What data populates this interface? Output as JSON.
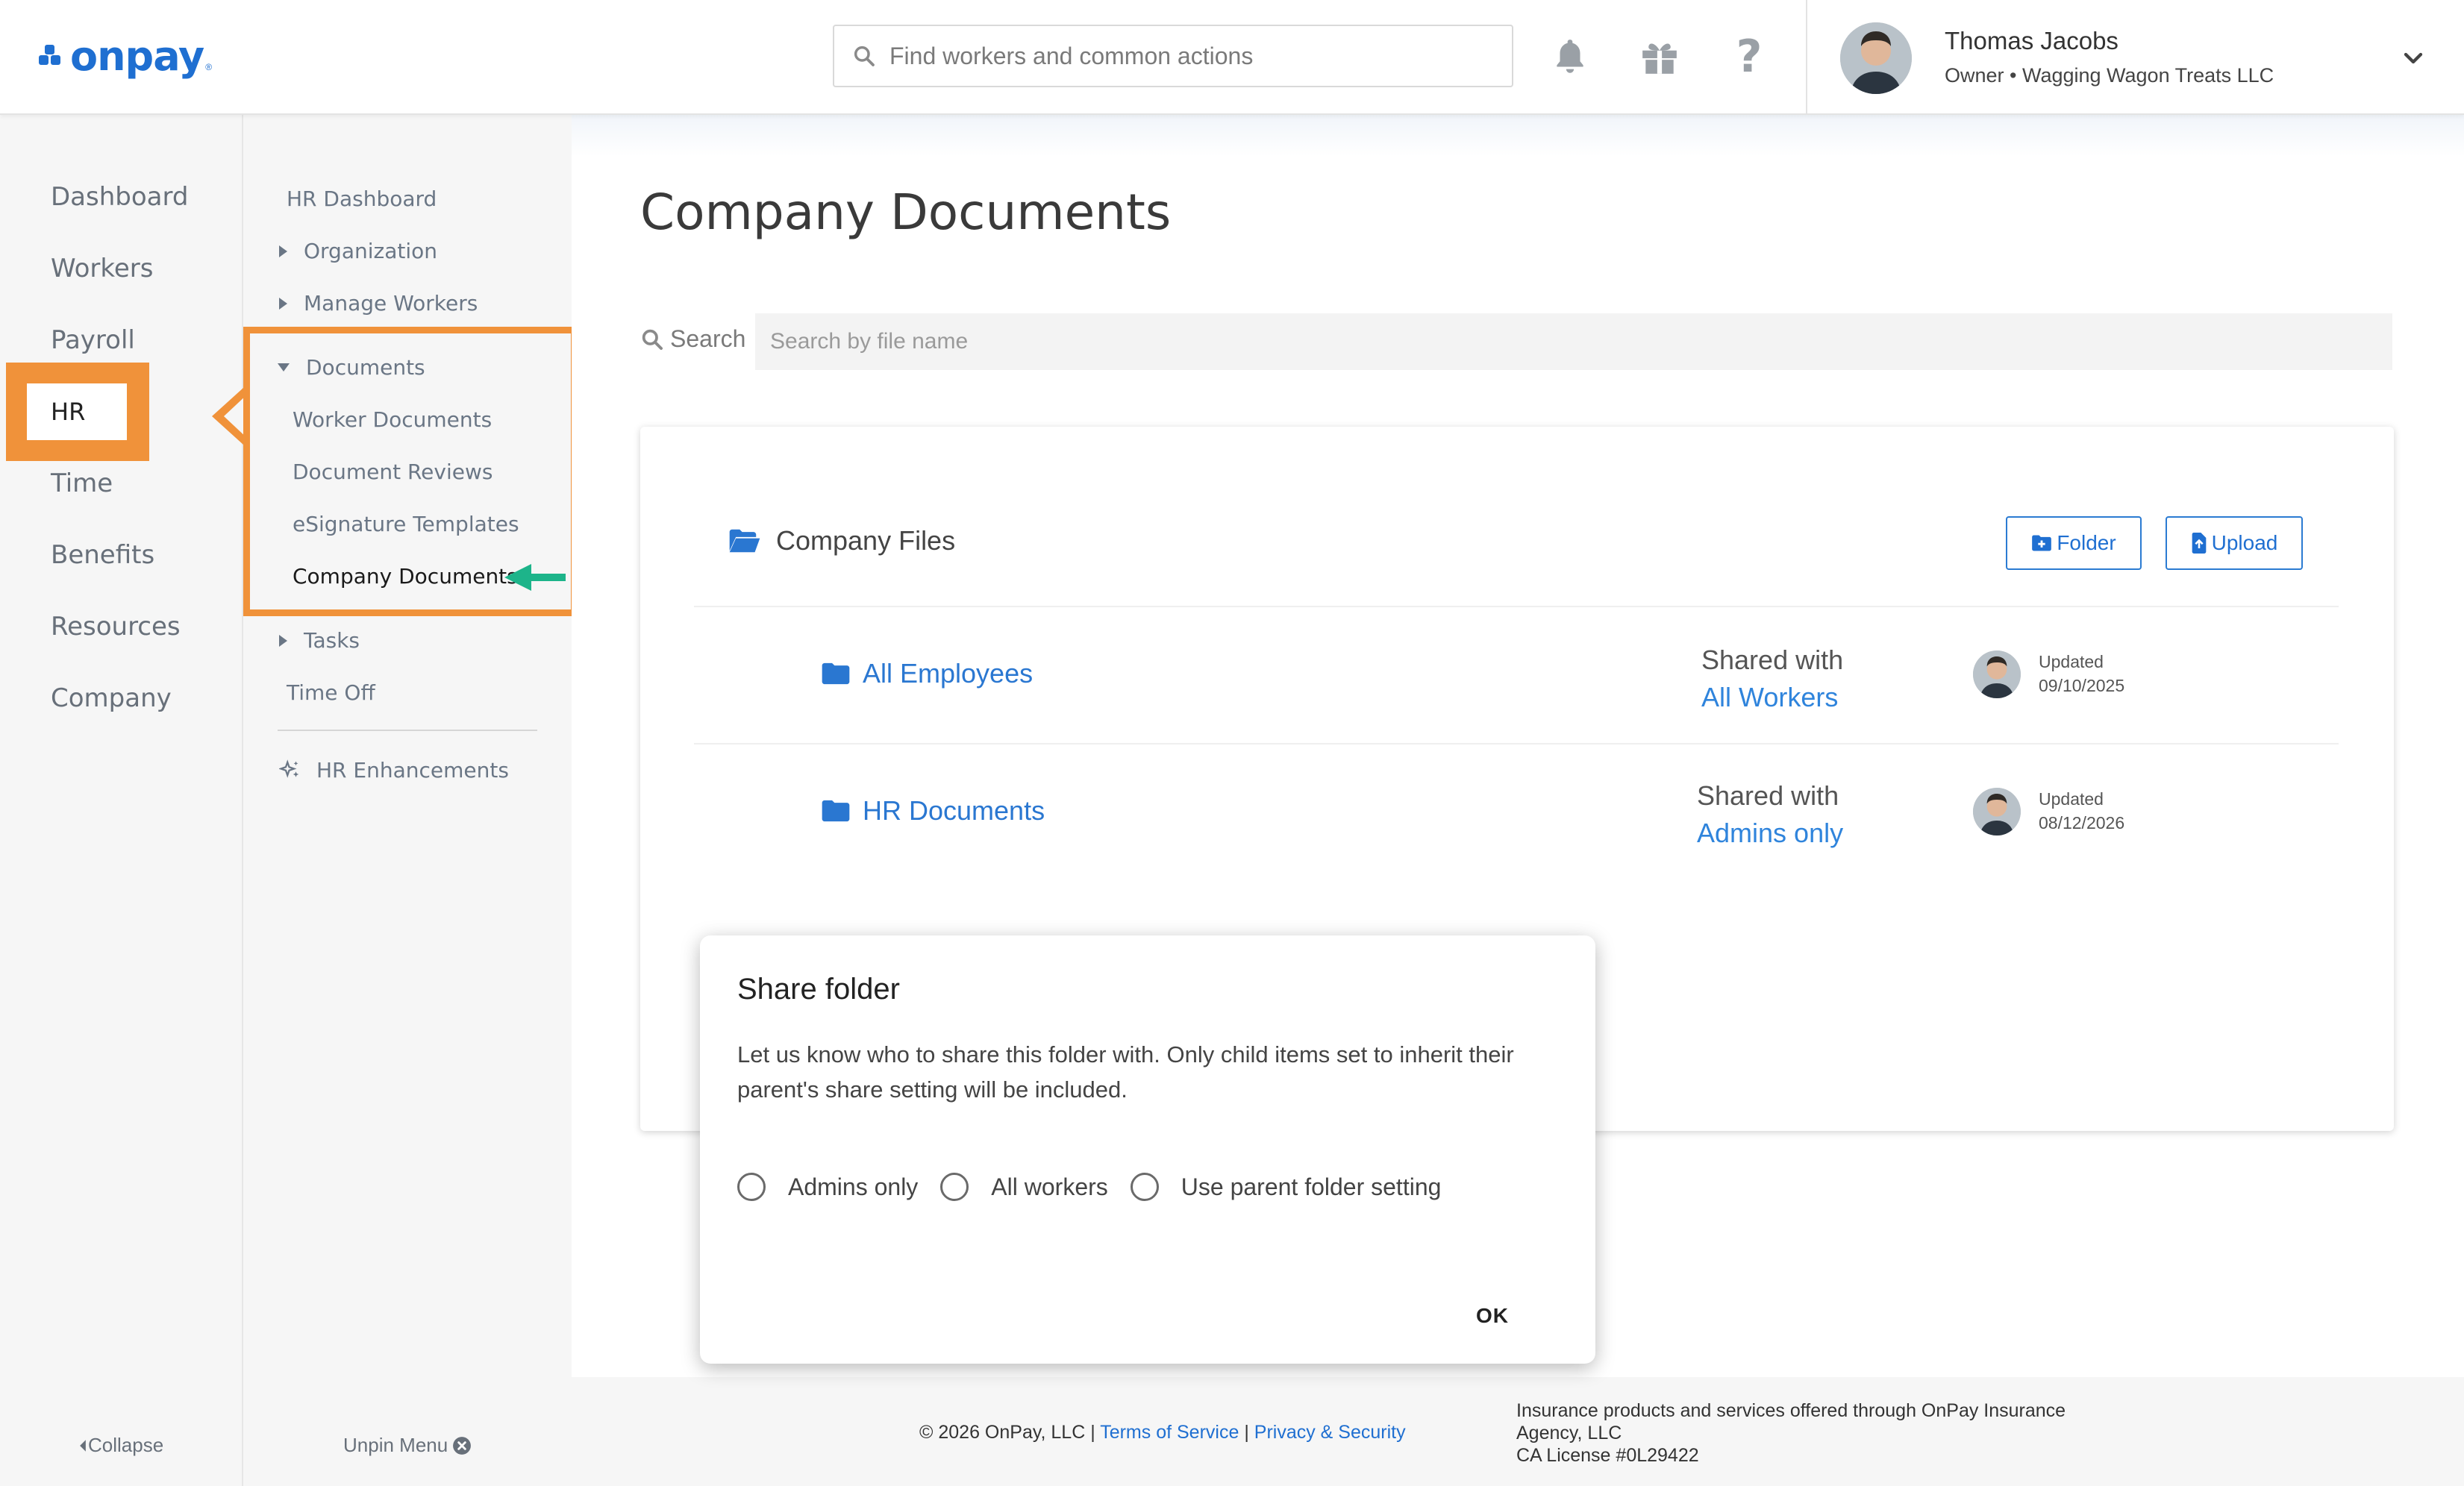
{
  "header": {
    "logo_text": "onpay",
    "logo_reg": "®",
    "search_placeholder": "Find workers and common actions",
    "icons": [
      "bell-icon",
      "gift-icon",
      "help-icon"
    ],
    "user": {
      "name": "Thomas Jacobs",
      "role": "Owner • Wagging Wagon Treats LLC"
    }
  },
  "primary_nav": {
    "items": [
      {
        "label": "Dashboard"
      },
      {
        "label": "Workers"
      },
      {
        "label": "Payroll"
      },
      {
        "label": "HR"
      },
      {
        "label": "Time"
      },
      {
        "label": "Benefits"
      },
      {
        "label": "Resources"
      },
      {
        "label": "Company"
      }
    ],
    "collapse_label": "Collapse"
  },
  "secondary_nav": {
    "hr_dashboard": "HR Dashboard",
    "organization": "Organization",
    "manage_workers": "Manage Workers",
    "documents": "Documents",
    "worker_documents": "Worker Documents",
    "document_reviews": "Document Reviews",
    "esignature_templates": "eSignature Templates",
    "company_documents": "Company Documents",
    "tasks": "Tasks",
    "time_off": "Time Off",
    "hr_enhancements": "HR Enhancements",
    "unpin_label": "Unpin Menu"
  },
  "main": {
    "page_title": "Company Documents",
    "search_label": "Search",
    "search_placeholder": "Search by file name",
    "card_title": "Company Files",
    "folder_button": "Folder",
    "upload_button": "Upload",
    "folders": [
      {
        "name": "All Employees",
        "shared_label": "Shared with",
        "shared_with": "All Workers",
        "updated_label": "Updated",
        "updated_date": "09/10/2025"
      },
      {
        "name": "HR Documents",
        "shared_label": "Shared with",
        "shared_with": "Admins only",
        "updated_label": "Updated",
        "updated_date": "08/12/2026"
      }
    ]
  },
  "dialog": {
    "title": "Share folder",
    "body": "Let us know who to share this folder with. Only child items set to inherit their parent's share setting will be included.",
    "options": [
      "Admins only",
      "All workers",
      "Use parent folder setting"
    ],
    "ok_label": "OK"
  },
  "footer": {
    "copyright": "© 2026 OnPay, LLC |",
    "terms": "Terms of Service",
    "sep": "|",
    "privacy": "Privacy & Security",
    "insurance_line1": "Insurance products and services offered through OnPay Insurance",
    "insurance_line2": "Agency, LLC",
    "insurance_line3": "CA License #0L29422"
  },
  "colors": {
    "brand": "#1f6fd1",
    "highlight_orange": "#f0923a",
    "arrow_green": "#1db48a"
  }
}
